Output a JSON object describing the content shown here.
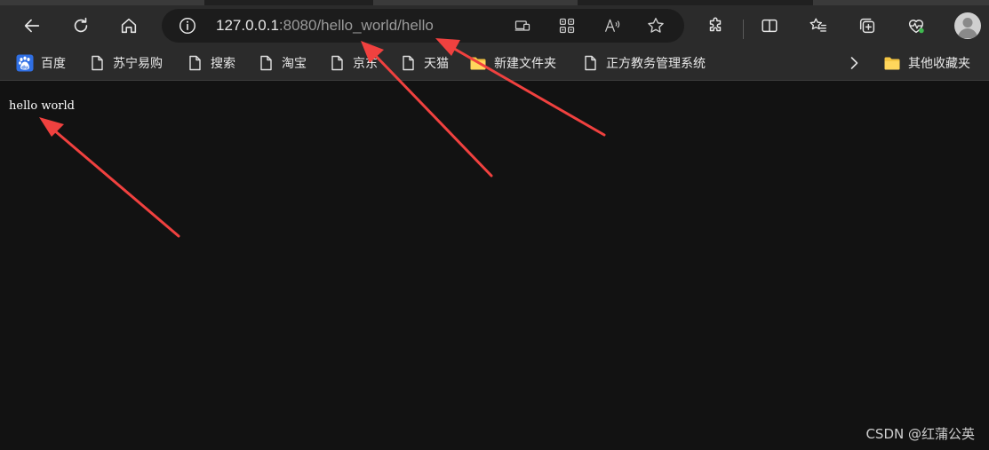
{
  "browser": {
    "address_bar": {
      "url_host": "127.0.0.1",
      "url_rest": ":8080/hello_world/hello"
    },
    "toolbar_icons": [
      "back-icon",
      "refresh-icon",
      "home-icon",
      "info-icon",
      "app-available-icon",
      "qr-code-icon",
      "read-aloud-icon",
      "favorite-star-icon",
      "extensions-icon",
      "split-screen-icon",
      "favorites-icon",
      "collections-icon",
      "browser-essentials-icon",
      "profile-avatar"
    ]
  },
  "bookmarks": {
    "items": [
      {
        "label": "百度",
        "icon": "baidu-icon"
      },
      {
        "label": "苏宁易购",
        "icon": "page-icon"
      },
      {
        "label": "搜索",
        "icon": "page-icon"
      },
      {
        "label": "淘宝",
        "icon": "page-icon"
      },
      {
        "label": "京东",
        "icon": "page-icon"
      },
      {
        "label": "天猫",
        "icon": "page-icon"
      },
      {
        "label": "新建文件夹",
        "icon": "folder-icon"
      },
      {
        "label": "正方教务管理系统",
        "icon": "page-icon"
      }
    ],
    "other_folder": "其他收藏夹"
  },
  "page": {
    "body_text": "hello world"
  },
  "watermark": "CSDN @红蒲公英",
  "colors": {
    "arrow": "#f0413f",
    "background": "#121212",
    "toolbar": "#2b2b2b"
  }
}
